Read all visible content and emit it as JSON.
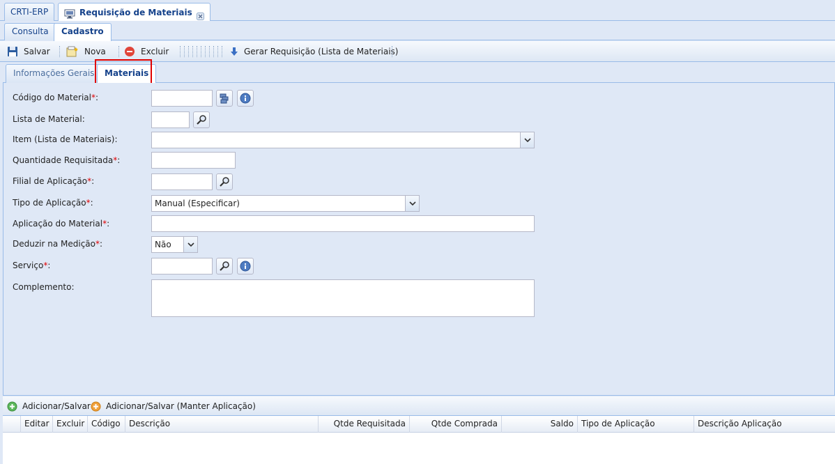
{
  "app_tabs": {
    "erp_label": "CRTI-ERP",
    "req_label": "Requisição de Materiais"
  },
  "sub_tabs": {
    "consulta": "Consulta",
    "cadastro": "Cadastro"
  },
  "toolbar": {
    "salvar": "Salvar",
    "nova": "Nova",
    "excluir": "Excluir",
    "gerar": "Gerar Requisição (Lista de Materiais)"
  },
  "inner_tabs": {
    "info": "Informações Gerais",
    "materiais": "Materiais"
  },
  "form": {
    "codigo_label": "Código do Material",
    "lista_label": "Lista de Material:",
    "item_label": "Item (Lista de Materiais):",
    "quantidade_label": "Quantidade Requisitada",
    "filial_label": "Filial de Aplicação",
    "tipo_label": "Tipo de Aplicação",
    "tipo_value": "Manual (Especificar)",
    "aplicacao_label": "Aplicação do Material",
    "deduzir_label": "Deduzir na Medição",
    "deduzir_value": "Não",
    "servico_label": "Serviço",
    "complemento_label": "Complemento:",
    "required_mark": "*",
    "colon": ":"
  },
  "bottom_toolbar": {
    "add_save": "Adicionar/Salvar",
    "add_save_keep": "Adicionar/Salvar (Manter Aplicação)"
  },
  "grid": {
    "columns": [
      "Editar",
      "Excluir",
      "Código",
      "Descrição",
      "Qtde Requisitada",
      "Qtde Comprada",
      "Saldo",
      "Tipo de Aplicação",
      "Descrição Aplicação"
    ]
  },
  "colors": {
    "header_text": "#15428b",
    "panel_bg": "#dfe8f6",
    "border": "#99bbe8",
    "highlight": "#e00000"
  }
}
